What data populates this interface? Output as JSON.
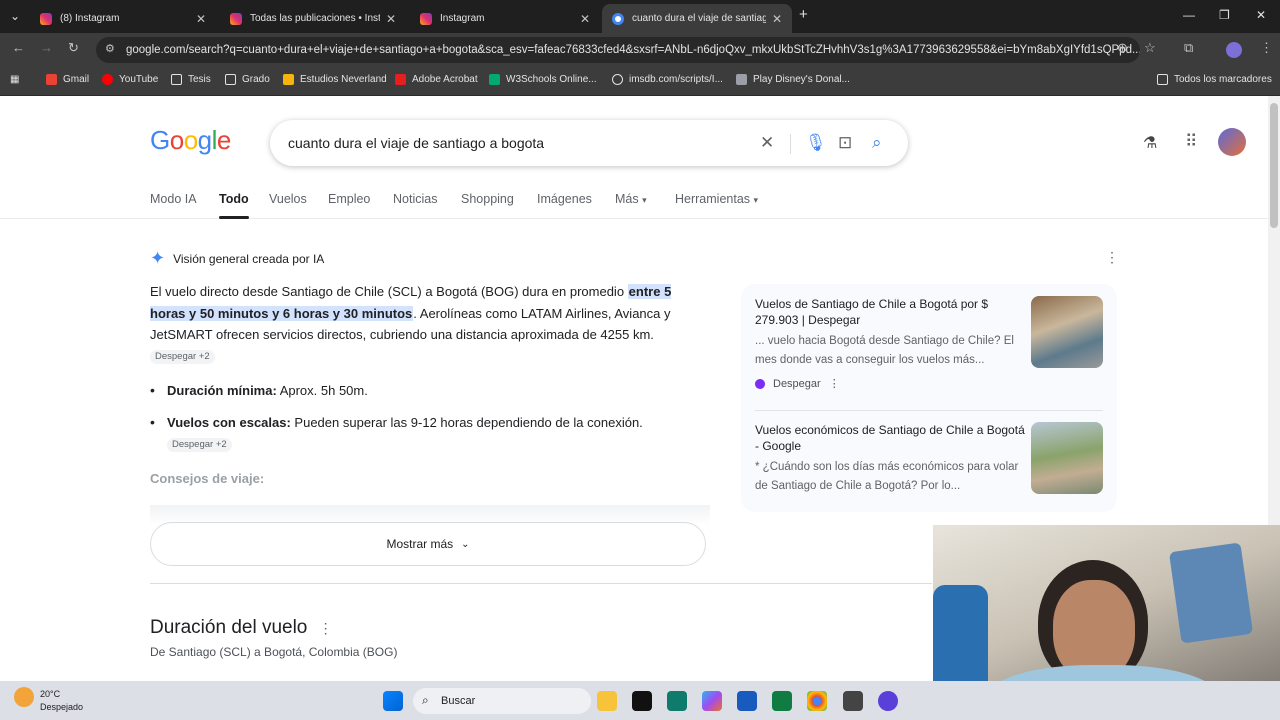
{
  "tabs": [
    {
      "label": "(8) Instagram",
      "active": false
    },
    {
      "label": "Todas las publicaciones • Instag",
      "active": false
    },
    {
      "label": "Instagram",
      "active": false
    },
    {
      "label": "cuanto dura el viaje de santiag",
      "active": true
    }
  ],
  "address": "google.com/search?q=cuanto+dura+el+viaje+de+santiago+a+bogota&sca_esv=fafeac76833cfed4&sxsrf=ANbL-n6djoQxv_mkxUkbStTcZHvhhV3s1g%3A1773963629558&ei=bYm8abXgIYfd1sQPpd...",
  "bookmarks": [
    "Gmail",
    "YouTube",
    "Tesis",
    "Grado",
    "Estudios Neverland",
    "Adobe Acrobat",
    "W3Schools Online...",
    "imsdb.com/scripts/I...",
    "Play Disney's Donal..."
  ],
  "all_bookmarks": "Todos los marcadores",
  "logo": "Google",
  "query": "cuanto dura el viaje de santiago a bogota",
  "nav_tabs": [
    "Modo IA",
    "Todo",
    "Vuelos",
    "Empleo",
    "Noticias",
    "Shopping",
    "Imágenes",
    "Más",
    "Herramientas"
  ],
  "ai": {
    "header": "Visión general creada por IA",
    "p1_a": "El vuelo directo desde Santiago de Chile (SCL) a Bogotá (BOG) dura en promedio",
    "p1_hl": "entre 5 horas y 50 minutos y 6 horas y 30 minutos",
    "p1_b": ". Aerolíneas como LATAM Airlines, Avianca y JetSMART ofrecen servicios directos, cubriendo una distancia aproximada de 4255 km.",
    "chip": "Despegar +2",
    "b1_label": "Duración mínima:",
    "b1_text": " Aprox. 5h 50m.",
    "b2_label": "Vuelos con escalas:",
    "b2_text": " Pueden superar las 9-12 horas dependiendo de la conexión.",
    "consejos": "Consejos de viaje:",
    "mostrar": "Mostrar más"
  },
  "sources": [
    {
      "title": "Vuelos de Santiago de Chile a Bogotá por $ 279.903 | Despegar",
      "snippet": "... vuelo hacia Bogotá desde Santiago de Chile? El mes donde vas a conseguir los vuelos más...",
      "site": "Despegar"
    },
    {
      "title": "Vuelos económicos de Santiago de Chile a Bogotá - Google",
      "snippet": "* ¿Cuándo son los días más económicos para volar de Santiago de Chile a Bogotá? Por lo...",
      "site": ""
    }
  ],
  "flight": {
    "title": "Duración del vuelo",
    "subtitle": "De Santiago (SCL) a Bogotá, Colombia (BOG)"
  },
  "taskbar": {
    "temp": "20°C",
    "weather": "Despejado",
    "search": "Buscar"
  }
}
